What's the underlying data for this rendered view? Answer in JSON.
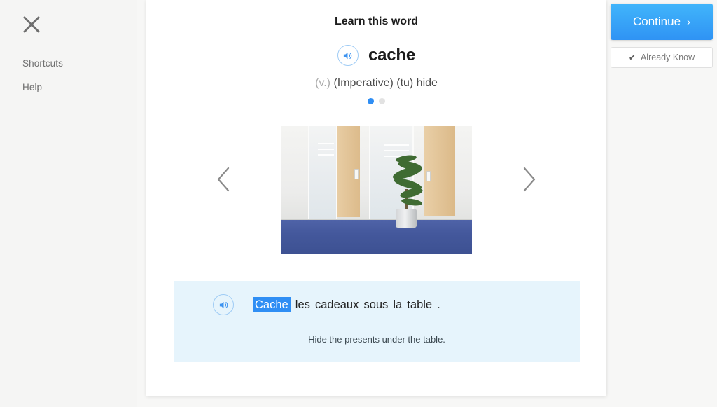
{
  "sidebar": {
    "close_icon": "close-icon",
    "links": [
      {
        "label": "Shortcuts"
      },
      {
        "label": "Help"
      }
    ]
  },
  "card": {
    "title": "Learn this word",
    "word": {
      "text": "cache",
      "audio_icon": "speaker-icon"
    },
    "definition": {
      "pos": "(v.)",
      "rest": "(Imperative) (tu) hide"
    },
    "pagination": {
      "total": 2,
      "active_index": 0
    },
    "carousel": {
      "prev_icon": "chevron-left-icon",
      "next_icon": "chevron-right-icon",
      "image_alt": "office corridor with doors, potted plant and blue carpet"
    },
    "sentence": {
      "audio_icon": "speaker-icon",
      "highlighted_word": "Cache",
      "rest": "les cadeaux sous la table .",
      "translation": "Hide the presents under the table."
    }
  },
  "actions": {
    "continue_label": "Continue",
    "continue_chevron": "›",
    "already_know_label": "Already Know",
    "already_know_check": "✔"
  },
  "colors": {
    "accent_blue": "#2f8ef4",
    "panel_blue": "#e6f4fc",
    "page_bg": "#f7f7f6",
    "sidebar_bg": "#f5f5f4"
  }
}
